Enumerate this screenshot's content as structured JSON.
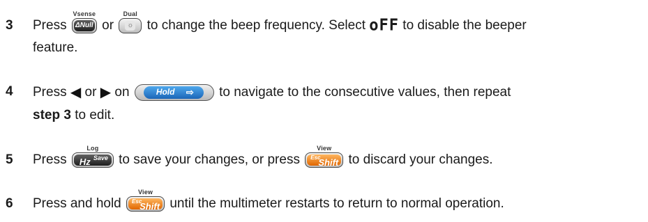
{
  "steps": [
    {
      "number": "3",
      "line1": {
        "t1": "Press",
        "key_a_caption": "Vsense",
        "key_a_label": "ΔNull",
        "t2": "or",
        "key_b_caption": "Dual",
        "key_b_icon": "☼",
        "t3": "to change the beep frequency. Select",
        "display_text": "oFF",
        "t4": "to disable the beeper"
      },
      "line2": "feature."
    },
    {
      "number": "4",
      "line1": {
        "t1": "Press",
        "left_arrow": "◀",
        "t2": "or",
        "right_arrow": "▶",
        "t3": "on",
        "key_label": "Hold",
        "key_icon": "⇨",
        "t4": "to navigate to the consecutive values, then repeat"
      },
      "line2": {
        "bold": "step 3",
        "rest": "to edit."
      }
    },
    {
      "number": "5",
      "line1": {
        "t1": "Press",
        "key_a_caption": "Log",
        "key_a_main": "Hz",
        "key_a_sub": "Save",
        "t2": "to save your changes, or press",
        "key_b_caption": "View",
        "key_b_main": "Shift",
        "key_b_sub": "Esc",
        "t3": "to discard your changes."
      }
    },
    {
      "number": "6",
      "line1": {
        "t1": "Press and hold",
        "key_caption": "View",
        "key_main": "Shift",
        "key_sub": "Esc",
        "t2": "until the multimeter restarts to return to normal operation."
      }
    }
  ]
}
